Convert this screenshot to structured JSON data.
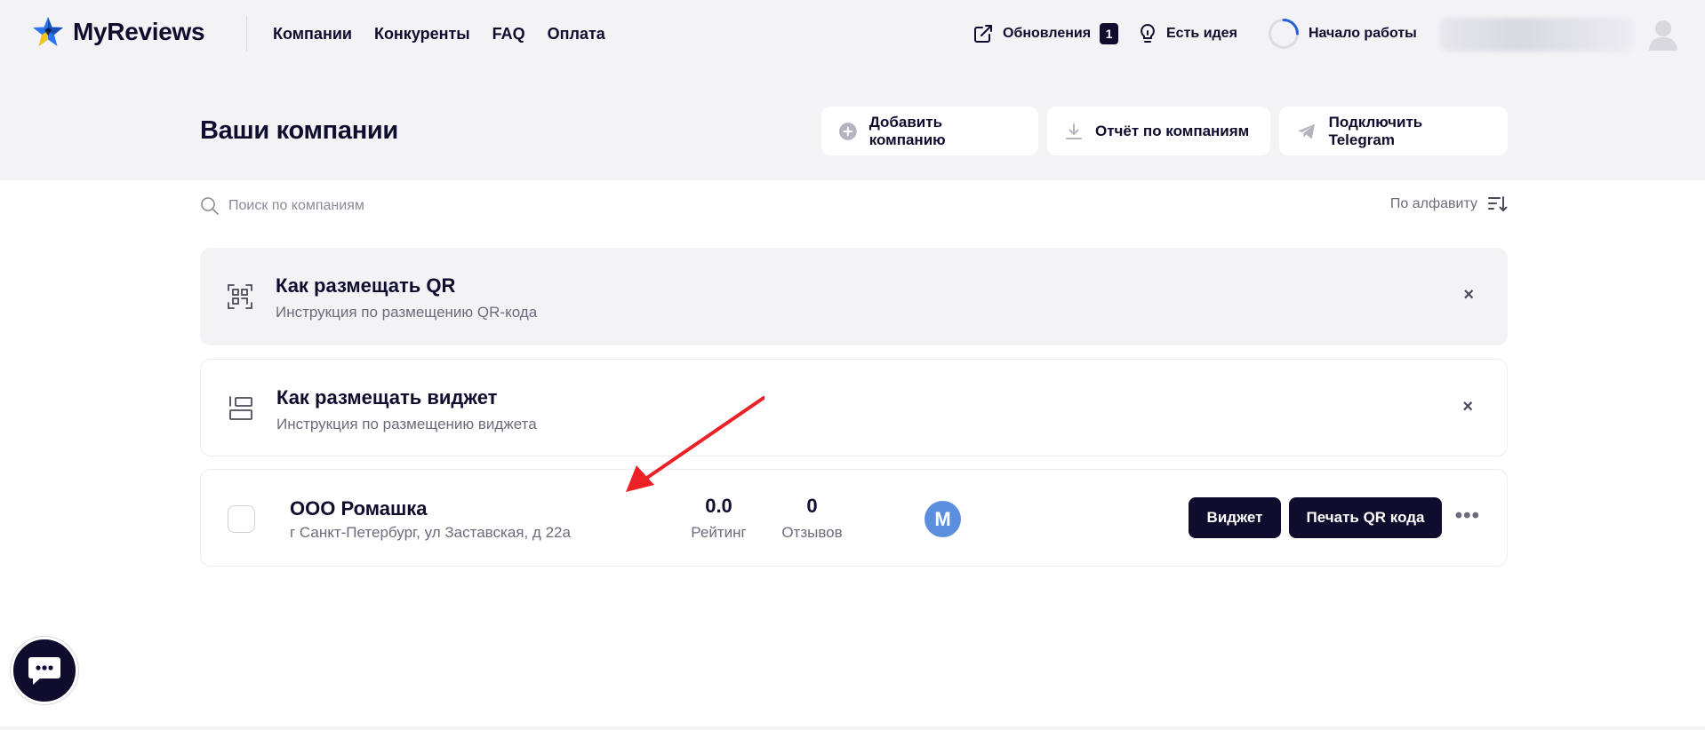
{
  "header": {
    "logo_text": "MyReviews",
    "nav": [
      "Компании",
      "Конкуренты",
      "FAQ",
      "Оплата"
    ],
    "updates_label": "Обновления",
    "updates_count": "1",
    "idea_label": "Есть идея",
    "start_label": "Начало работы",
    "start_progress": 0.25
  },
  "page": {
    "title": "Ваши компании",
    "add_company": "Добавить компанию",
    "report": "Отчёт по компаниям",
    "telegram": "Подключить Telegram"
  },
  "search": {
    "placeholder": "Поиск по компаниям",
    "sort_label": "По алфавиту"
  },
  "info_cards": [
    {
      "title": "Как размещать QR",
      "subtitle": "Инструкция по размещению QR-кода",
      "close": "×"
    },
    {
      "title": "Как размещать виджет",
      "subtitle": "Инструкция по размещению виджета",
      "close": "×"
    }
  ],
  "company": {
    "name": "ООО Ромашка",
    "address": "г Санкт-Петербург, ул Заставская, д 22а",
    "rating_value": "0.0",
    "rating_label": "Рейтинг",
    "reviews_value": "0",
    "reviews_label": "Отзывов",
    "badge_letter": "M",
    "widget_btn": "Виджет",
    "qr_btn": "Печать QR кода",
    "more": "•••"
  },
  "colors": {
    "primary_dark": "#0f0c2e",
    "bg_light": "#f3f3f6",
    "badge_blue": "#5b8fdd",
    "arrow_red": "#ec2027",
    "logo_blue": "#2b76f0",
    "logo_yellow": "#f5c518"
  },
  "icons": {
    "logo": "star-logo-icon",
    "updates": "external-link-icon",
    "idea": "lightbulb-icon",
    "start": "progress-ring-icon",
    "add": "plus-circle-icon",
    "report": "download-icon",
    "telegram": "telegram-plane-icon",
    "search": "search-icon",
    "sort": "sort-icon",
    "qr": "qr-scan-icon",
    "widget": "widget-layout-icon",
    "chat": "chat-icon"
  }
}
